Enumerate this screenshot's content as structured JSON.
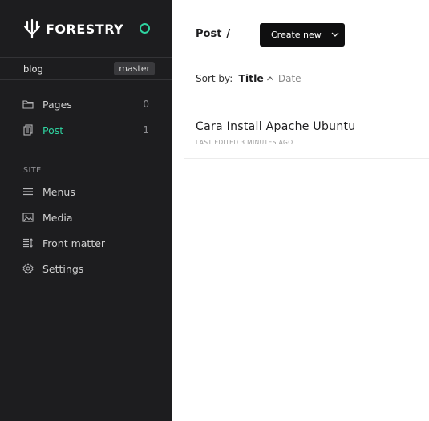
{
  "brand": {
    "name": "FORESTRY",
    "status_color": "#2fd3a0"
  },
  "site": {
    "name": "blog",
    "branch": "master"
  },
  "nav": {
    "content": [
      {
        "label": "Pages",
        "count": "0",
        "icon": "folder-icon"
      },
      {
        "label": "Post",
        "count": "1",
        "icon": "documents-icon",
        "active": true
      }
    ],
    "site_section_label": "SITE",
    "site": [
      {
        "label": "Menus",
        "icon": "menu-icon"
      },
      {
        "label": "Media",
        "icon": "image-icon"
      },
      {
        "label": "Front matter",
        "icon": "front-matter-icon"
      },
      {
        "label": "Settings",
        "icon": "gear-icon"
      }
    ]
  },
  "main": {
    "breadcrumb": {
      "section": "Post",
      "separator": "/"
    },
    "create_button": {
      "label": "Create new"
    },
    "sort": {
      "label": "Sort by:",
      "options": [
        "Title",
        "Date"
      ],
      "active": "Title"
    },
    "posts": [
      {
        "title": "Cara Install Apache Ubuntu",
        "meta": "LAST EDITED 3 MINUTES AGO"
      }
    ]
  },
  "colors": {
    "sidebar_bg": "#1d1d1f",
    "accent": "#2fd3a0",
    "button_bg": "#0f0f10"
  }
}
